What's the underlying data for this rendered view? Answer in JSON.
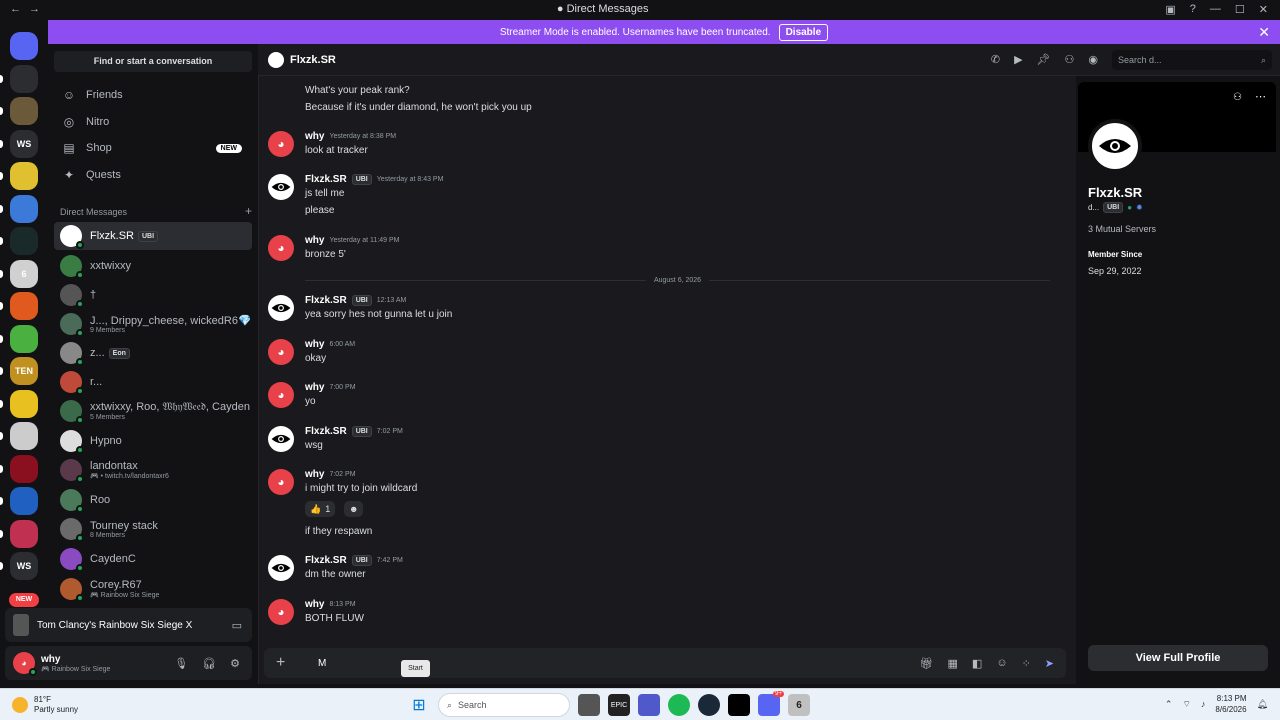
{
  "window": {
    "title": "Direct Messages"
  },
  "banner": {
    "text": "Streamer Mode is enabled. Usernames have been truncated.",
    "button": "Disable"
  },
  "guilds": [
    {
      "label": "",
      "color": "#5865f2",
      "badge": ""
    },
    {
      "label": "",
      "color": "#2b2d31",
      "badge": "284"
    },
    {
      "label": "",
      "color": "#6b5a3a",
      "badge": ""
    },
    {
      "label": "WS",
      "color": "#2b2d31",
      "badge": ""
    },
    {
      "label": "",
      "color": "#e0c030",
      "badge": ""
    },
    {
      "label": "",
      "color": "#3b7ad8",
      "badge": ""
    },
    {
      "label": "",
      "color": "#1a2a2a",
      "badge": ""
    },
    {
      "label": "6",
      "color": "#d0d0d0",
      "badge": ""
    },
    {
      "label": "",
      "color": "#e05a20",
      "badge": "3"
    },
    {
      "label": "",
      "color": "#4ab040",
      "badge": "3"
    },
    {
      "label": "TEN",
      "color": "#c09020",
      "badge": "2"
    },
    {
      "label": "",
      "color": "#e8c020",
      "badge": "1"
    },
    {
      "label": "",
      "color": "#cccccc",
      "badge": ""
    },
    {
      "label": "",
      "color": "#8a1020",
      "badge": "96"
    },
    {
      "label": "",
      "color": "#2060c0",
      "badge": ""
    },
    {
      "label": "",
      "color": "#c03050",
      "badge": ""
    },
    {
      "label": "WS",
      "color": "#2b2d31",
      "badge": ""
    },
    {
      "label": "NEW",
      "color": "#f23f43",
      "badge": ""
    }
  ],
  "sidebar": {
    "find": "Find or start a conversation",
    "nav": [
      {
        "label": "Friends",
        "icon": "friends-icon",
        "glyph": "☺"
      },
      {
        "label": "Nitro",
        "icon": "nitro-icon",
        "glyph": "◎"
      },
      {
        "label": "Shop",
        "icon": "shop-icon",
        "glyph": "▤",
        "badge": "NEW"
      },
      {
        "label": "Quests",
        "icon": "quests-icon",
        "glyph": "✦"
      }
    ],
    "dm_header": "Direct Messages",
    "dms": [
      {
        "name": "Flxzk.SR",
        "tag": "UBI",
        "sub": "",
        "active": true,
        "color": "#ffffff"
      },
      {
        "name": "xxtwixxy",
        "tag": "",
        "sub": "",
        "active": false,
        "color": "#3a7d44"
      },
      {
        "name": "†",
        "tag": "",
        "sub": "",
        "active": false,
        "color": "#555555"
      },
      {
        "name": "J..., Drippy_cheese, wickedR6💎...",
        "tag": "",
        "sub": "9 Members",
        "active": false,
        "color": "#4a6a5a"
      },
      {
        "name": "z...",
        "tag": "Eon",
        "sub": "",
        "active": false,
        "color": "#888888"
      },
      {
        "name": "r...",
        "tag": "",
        "sub": "",
        "active": false,
        "color": "#c04a3a"
      },
      {
        "name": "xxtwixxy, Roo, 𝔚𝔥𝔶𝔚𝔢𝔢𝔡, CaydenC",
        "tag": "",
        "sub": "5 Members",
        "active": false,
        "color": "#3a6a4a"
      },
      {
        "name": "Hypno",
        "tag": "",
        "sub": "",
        "active": false,
        "color": "#dddddd"
      },
      {
        "name": "landontax",
        "tag": "",
        "sub": "🎮 • twitch.tv/landontaxr6",
        "active": false,
        "color": "#5a3a4a"
      },
      {
        "name": "Roo",
        "tag": "",
        "sub": "",
        "active": false,
        "color": "#4a7a5a"
      },
      {
        "name": "Tourney stack",
        "tag": "",
        "sub": "8 Members",
        "active": false,
        "color": "#6a6a6a"
      },
      {
        "name": "CaydenC",
        "tag": "",
        "sub": "",
        "active": false,
        "color": "#8a4ac0"
      },
      {
        "name": "Corey.R67",
        "tag": "",
        "sub": "🎮 Rainbow Six Siege",
        "active": false,
        "color": "#b05a30"
      }
    ],
    "game": "Tom Clancy's Rainbow Six Siege X",
    "user": {
      "name": "why",
      "status": "🎮 Rainbow Six Siege"
    }
  },
  "chat": {
    "header": "Flxzk.SR",
    "search_placeholder": "Search d...",
    "date_divider": "August 6, 2026",
    "top_lines": [
      "What's your peak rank?",
      "Because if it's under diamond, he won't pick you up"
    ],
    "messages": [
      {
        "author": "why",
        "tag": "",
        "time": "Yesterday at 8:38 PM",
        "lines": [
          "look at tracker"
        ]
      },
      {
        "author": "Flxzk.SR",
        "tag": "UBI",
        "time": "Yesterday at 8:43 PM",
        "lines": [
          "js tell me",
          "please"
        ]
      },
      {
        "author": "why",
        "tag": "",
        "time": "Yesterday at 11:49 PM",
        "lines": [
          "bronze 5'"
        ]
      },
      {
        "author": "Flxzk.SR",
        "tag": "UBI",
        "time": "12:13 AM",
        "lines": [
          "yea sorry hes not gunna let u join"
        ]
      },
      {
        "author": "why",
        "tag": "",
        "time": "6:00 AM",
        "lines": [
          "okay"
        ]
      },
      {
        "author": "why",
        "tag": "",
        "time": "7:00 PM",
        "lines": [
          "yo"
        ]
      },
      {
        "author": "Flxzk.SR",
        "tag": "UBI",
        "time": "7:02 PM",
        "lines": [
          "wsg"
        ]
      },
      {
        "author": "why",
        "tag": "",
        "time": "7:02 PM",
        "lines": [
          "i might try to join wildcard",
          "if they respawn"
        ]
      },
      {
        "author": "Flxzk.SR",
        "tag": "UBI",
        "time": "7:42 PM",
        "lines": [
          "dm the owner"
        ]
      },
      {
        "author": "why",
        "tag": "",
        "time": "8:13 PM",
        "lines": [
          "BOTH FLUW"
        ]
      }
    ],
    "reaction": {
      "emoji": "👍",
      "count": "1"
    },
    "composer_value": "M",
    "tooltip": "Start"
  },
  "profile": {
    "name": "Flxzk.SR",
    "handle": "d...",
    "tag": "UBI",
    "mutual": "3 Mutual Servers",
    "member_since_label": "Member Since",
    "member_since": "Sep 29, 2022",
    "view_full": "View Full Profile"
  },
  "taskbar": {
    "temp": "81°F",
    "weather": "Partly sunny",
    "search": "Search",
    "time": "8:13 PM",
    "date": "8/6/2026",
    "discord_badge": "9+"
  }
}
